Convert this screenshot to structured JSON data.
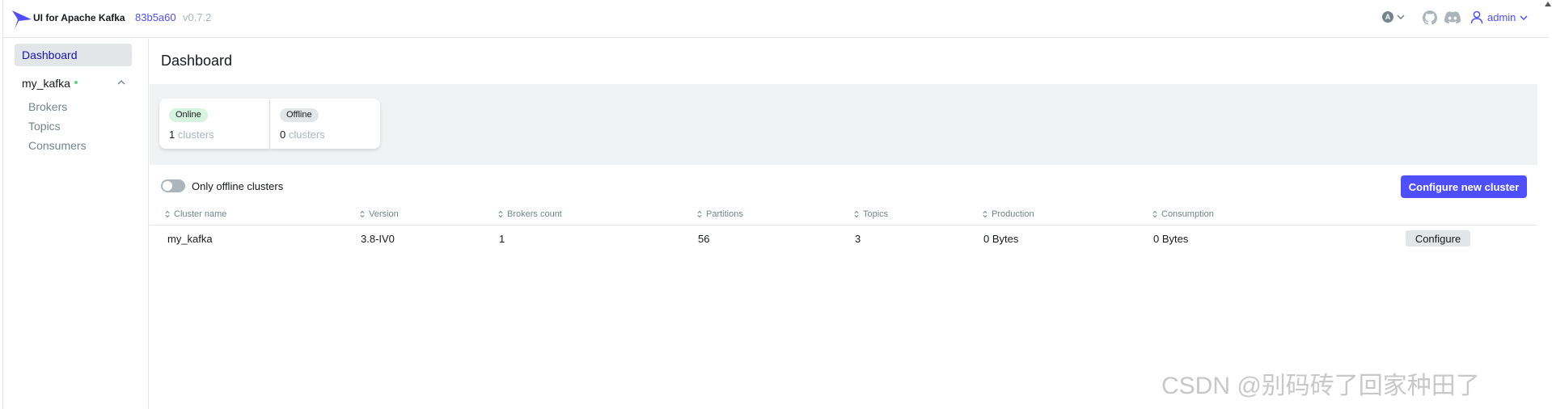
{
  "header": {
    "app_title": "UI for Apache Kafka",
    "commit": "83b5a60",
    "version": "v0.7.2",
    "theme_letter": "A",
    "user": "admin"
  },
  "sidebar": {
    "dashboard": "Dashboard",
    "cluster": "my_kafka",
    "items": [
      "Brokers",
      "Topics",
      "Consumers"
    ]
  },
  "main": {
    "title": "Dashboard",
    "online": {
      "tag": "Online",
      "count": "1",
      "unit": "clusters"
    },
    "offline": {
      "tag": "Offline",
      "count": "0",
      "unit": "clusters"
    },
    "toggle_label": "Only offline clusters",
    "configure_new": "Configure new cluster",
    "columns": [
      "Cluster name",
      "Version",
      "Brokers count",
      "Partitions",
      "Topics",
      "Production",
      "Consumption"
    ],
    "rows": [
      {
        "name": "my_kafka",
        "version": "3.8-IV0",
        "brokers": "1",
        "partitions": "56",
        "topics": "3",
        "production": "0 Bytes",
        "consumption": "0 Bytes",
        "action": "Configure"
      }
    ]
  },
  "watermark": "CSDN @别码砖了回家种田了",
  "colors": {
    "accent": "#4f4fff",
    "online": "#d6f5e0",
    "band": "#f1f2f3"
  }
}
